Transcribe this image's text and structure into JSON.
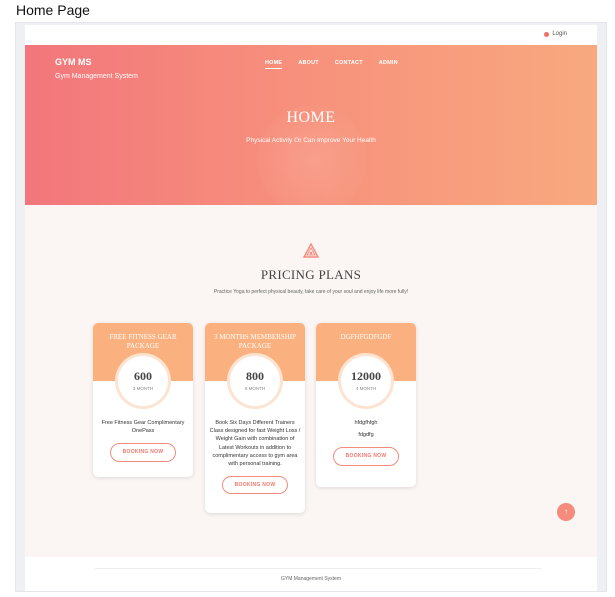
{
  "document": {
    "title": "Home Page"
  },
  "topbar": {
    "login_label": "Login"
  },
  "header": {
    "brand": "GYM MS",
    "tagline": "Gym Management System",
    "nav": [
      {
        "label": "HOME"
      },
      {
        "label": "ABOUT"
      },
      {
        "label": "CONTACT"
      },
      {
        "label": "ADMIN"
      }
    ],
    "hero_title": "HOME",
    "hero_subtitle": "Physical Activity Or Can Improve Your Health"
  },
  "pricing": {
    "title": "PRICING PLANS",
    "subtitle": "Practice Yoga to perfect physical beauty, take care of your soul and enjoy life more fully!",
    "plans": [
      {
        "name": "FREE FITNESS GEAR PACKAGE",
        "price": "600",
        "period": "3 MONTH",
        "description": "Free Fitness Gear Complimentary OnePass",
        "button": "BOOKING NOW"
      },
      {
        "name": "3 MONTHS MEMBERSHIP PACKAGE",
        "price": "800",
        "period": "6 MONTH",
        "description": "Book Six Days Different Trainers Class designed for fast Weight Loss / Weight Gain with combination of Latest Workouts in addition to complimentary access to gym area with personal training.",
        "button": "BOOKING NOW"
      },
      {
        "name": "DGFHFGDFGDF",
        "price": "12000",
        "period": "4 MONTH",
        "description_lines": [
          "hfdgfhfgh",
          "fdgdfg"
        ],
        "button": "BOOKING NOW"
      }
    ]
  },
  "footer": {
    "text": "GYM Management System"
  },
  "colors": {
    "accent": "#f48b7c",
    "card_head": "#fbb17f",
    "hero_start": "#f2767c",
    "hero_end": "#f8a97e"
  },
  "icons": {
    "login": "user-icon",
    "pricing": "triangle-logo-icon",
    "scroll_top": "arrow-up-icon"
  }
}
